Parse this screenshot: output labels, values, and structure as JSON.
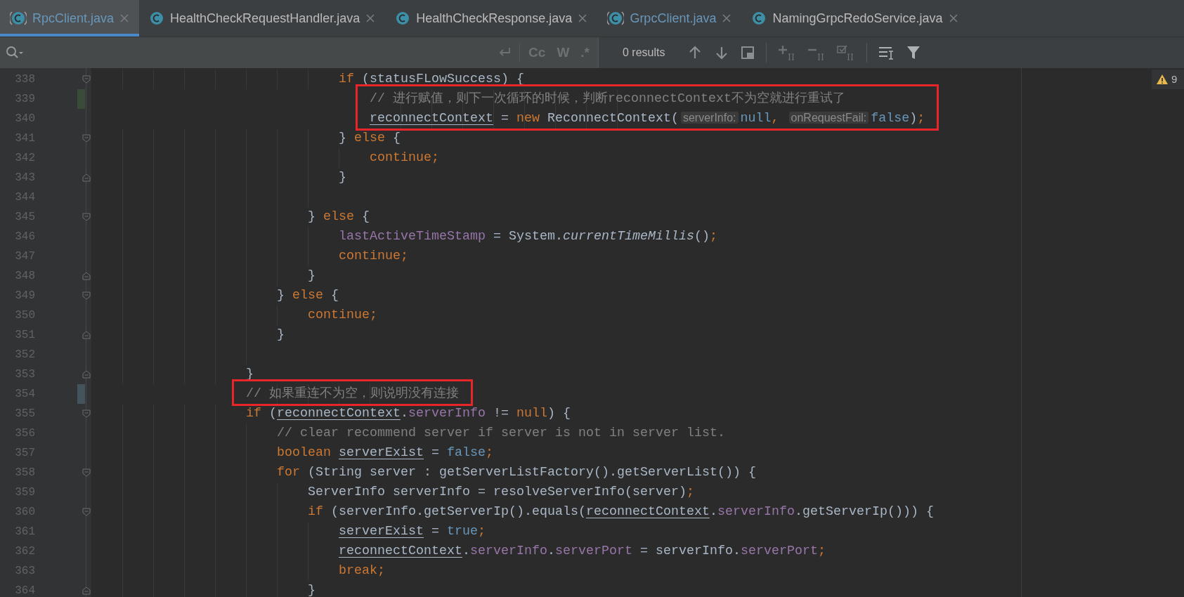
{
  "tabs": [
    {
      "label": "RpcClient.java",
      "selected": true,
      "modified": true,
      "kind": "abstract"
    },
    {
      "label": "HealthCheckRequestHandler.java",
      "selected": false,
      "modified": false,
      "kind": "plain"
    },
    {
      "label": "HealthCheckResponse.java",
      "selected": false,
      "modified": false,
      "kind": "plain"
    },
    {
      "label": "GrpcClient.java",
      "selected": false,
      "modified": true,
      "kind": "abstract"
    },
    {
      "label": "NamingGrpcRedoService.java",
      "selected": false,
      "modified": false,
      "kind": "plain"
    }
  ],
  "find_bar": {
    "options": [
      {
        "label": "Cc",
        "selected": false
      },
      {
        "label": "W",
        "selected": false
      },
      {
        "label": ".*",
        "selected": false
      }
    ],
    "results": "0 results"
  },
  "inspection": {
    "count": "9"
  },
  "lines": [
    {
      "children": [
        {
          "children": [
            {
              "children": [
                {
                  "number": "338",
                  "fold_start": true,
                  "fold_end": false,
                  "added": false,
                  "modified": false,
                  "boxed": false,
                  "tokens": [
                    {
                      "kind": "keyword",
                      "text": "if"
                    },
                    {
                      "kind": "plain",
                      "text": " (statusFLowSuccess) {"
                    }
                  ],
                  "children": [
                    {
                      "number": "339",
                      "fold_start": false,
                      "fold_end": false,
                      "added": true,
                      "modified": false,
                      "boxed": true,
                      "tokens": [
                        {
                          "kind": "comment",
                          "text": "// 进行赋值，则下一次循环的时候，判断reconnectContext不为空就进行重试了"
                        }
                      ]
                    },
                    {
                      "number": "340",
                      "fold_start": false,
                      "fold_end": false,
                      "added": false,
                      "modified": false,
                      "boxed": true,
                      "tokens": [
                        {
                          "kind": "variable",
                          "text": "reconnectContext"
                        },
                        {
                          "kind": "plain",
                          "text": " = "
                        },
                        {
                          "kind": "keyword",
                          "text": "new"
                        },
                        {
                          "kind": "plain",
                          "text": " ReconnectContext("
                        },
                        {
                          "kind": "hint",
                          "text": "serverInfo:"
                        },
                        {
                          "kind": "literal",
                          "text": "null"
                        },
                        {
                          "kind": "keyword",
                          "text": ", "
                        },
                        {
                          "kind": "hint",
                          "text": "onRequestFail:"
                        },
                        {
                          "kind": "literal",
                          "text": "false"
                        },
                        {
                          "kind": "plain",
                          "text": ")"
                        },
                        {
                          "kind": "keyword",
                          "text": ";"
                        }
                      ]
                    }
                  ]
                },
                {
                  "number": "341",
                  "fold_start": true,
                  "fold_end": false,
                  "added": false,
                  "modified": false,
                  "boxed": false,
                  "tokens": [
                    {
                      "kind": "plain",
                      "text": "} "
                    },
                    {
                      "kind": "keyword",
                      "text": "else"
                    },
                    {
                      "kind": "plain",
                      "text": " {"
                    }
                  ],
                  "children": [
                    {
                      "number": "342",
                      "fold_start": false,
                      "fold_end": false,
                      "added": false,
                      "modified": false,
                      "boxed": false,
                      "tokens": [
                        {
                          "kind": "keyword",
                          "text": "continue;"
                        }
                      ]
                    }
                  ]
                },
                {
                  "number": "343",
                  "fold_start": false,
                  "fold_end": true,
                  "added": false,
                  "modified": false,
                  "boxed": false,
                  "tokens": [
                    {
                      "kind": "plain",
                      "text": "}"
                    }
                  ]
                },
                {
                  "number": "344",
                  "fold_start": false,
                  "fold_end": false,
                  "added": false,
                  "modified": false,
                  "boxed": false
                }
              ]
            },
            {
              "number": "345",
              "fold_start": true,
              "fold_end": false,
              "added": false,
              "modified": false,
              "boxed": false,
              "tokens": [
                {
                  "kind": "plain",
                  "text": "} "
                },
                {
                  "kind": "keyword",
                  "text": "else"
                },
                {
                  "kind": "plain",
                  "text": " {"
                }
              ],
              "children": [
                {
                  "number": "346",
                  "fold_start": false,
                  "fold_end": false,
                  "added": false,
                  "modified": false,
                  "boxed": false,
                  "tokens": [
                    {
                      "kind": "field",
                      "text": "lastActiveTimeStamp"
                    },
                    {
                      "kind": "plain",
                      "text": " = System."
                    },
                    {
                      "kind": "static",
                      "text": "currentTimeMillis"
                    },
                    {
                      "kind": "plain",
                      "text": "()"
                    },
                    {
                      "kind": "keyword",
                      "text": ";"
                    }
                  ]
                },
                {
                  "number": "347",
                  "fold_start": false,
                  "fold_end": false,
                  "added": false,
                  "modified": false,
                  "boxed": false,
                  "tokens": [
                    {
                      "kind": "keyword",
                      "text": "continue;"
                    }
                  ]
                }
              ]
            },
            {
              "number": "348",
              "fold_start": false,
              "fold_end": true,
              "added": false,
              "modified": false,
              "boxed": false,
              "tokens": [
                {
                  "kind": "plain",
                  "text": "}"
                }
              ]
            }
          ]
        },
        {
          "number": "349",
          "fold_start": true,
          "fold_end": false,
          "added": false,
          "modified": false,
          "boxed": false,
          "tokens": [
            {
              "kind": "plain",
              "text": "} "
            },
            {
              "kind": "keyword",
              "text": "else"
            },
            {
              "kind": "plain",
              "text": " {"
            }
          ],
          "children": [
            {
              "number": "350",
              "fold_start": false,
              "fold_end": false,
              "added": false,
              "modified": false,
              "boxed": false,
              "tokens": [
                {
                  "kind": "keyword",
                  "text": "continue;"
                }
              ]
            }
          ]
        },
        {
          "number": "351",
          "fold_start": false,
          "fold_end": true,
          "added": false,
          "modified": false,
          "boxed": false,
          "tokens": [
            {
              "kind": "plain",
              "text": "}"
            }
          ]
        },
        {
          "number": "352",
          "fold_start": false,
          "fold_end": false,
          "added": false,
          "modified": false,
          "boxed": false
        }
      ]
    },
    {
      "number": "353",
      "fold_start": false,
      "fold_end": true,
      "added": false,
      "modified": false,
      "boxed": false,
      "tokens": [
        {
          "kind": "plain",
          "text": "}"
        }
      ]
    },
    {
      "number": "354",
      "fold_start": false,
      "fold_end": false,
      "added": false,
      "modified": true,
      "boxed": true,
      "tokens": [
        {
          "kind": "comment",
          "text": "// 如果重连不为空，则说明没有连接"
        }
      ]
    },
    {
      "number": "355",
      "fold_start": true,
      "fold_end": false,
      "added": false,
      "modified": false,
      "boxed": false,
      "tokens": [
        {
          "kind": "keyword",
          "text": "if"
        },
        {
          "kind": "plain",
          "text": " ("
        },
        {
          "kind": "variable",
          "text": "reconnectContext"
        },
        {
          "kind": "plain",
          "text": "."
        },
        {
          "kind": "field",
          "text": "serverInfo"
        },
        {
          "kind": "plain",
          "text": " != "
        },
        {
          "kind": "keyword",
          "text": "null"
        },
        {
          "kind": "plain",
          "text": ") {"
        }
      ],
      "children": [
        {
          "number": "356",
          "fold_start": false,
          "fold_end": false,
          "added": false,
          "modified": false,
          "boxed": false,
          "tokens": [
            {
              "kind": "comment",
              "text": "// clear recommend server if server is not in server list."
            }
          ]
        },
        {
          "number": "357",
          "fold_start": false,
          "fold_end": false,
          "added": false,
          "modified": false,
          "boxed": false,
          "tokens": [
            {
              "kind": "keyword",
              "text": "boolean "
            },
            {
              "kind": "variable",
              "text": "serverExist"
            },
            {
              "kind": "plain",
              "text": " = "
            },
            {
              "kind": "literal",
              "text": "false"
            },
            {
              "kind": "keyword",
              "text": ";"
            }
          ]
        },
        {
          "number": "358",
          "fold_start": true,
          "fold_end": false,
          "added": false,
          "modified": false,
          "boxed": false,
          "tokens": [
            {
              "kind": "keyword",
              "text": "for"
            },
            {
              "kind": "plain",
              "text": " (String server : getServerListFactory().getServerList()) {"
            }
          ],
          "children": [
            {
              "number": "359",
              "fold_start": false,
              "fold_end": false,
              "added": false,
              "modified": false,
              "boxed": false,
              "tokens": [
                {
                  "kind": "plain",
                  "text": "ServerInfo serverInfo = resolveServerInfo(server)"
                },
                {
                  "kind": "keyword",
                  "text": ";"
                }
              ]
            },
            {
              "number": "360",
              "fold_start": true,
              "fold_end": false,
              "added": false,
              "modified": false,
              "boxed": false,
              "tokens": [
                {
                  "kind": "keyword",
                  "text": "if"
                },
                {
                  "kind": "plain",
                  "text": " (serverInfo.getServerIp().equals("
                },
                {
                  "kind": "variable",
                  "text": "reconnectContext"
                },
                {
                  "kind": "plain",
                  "text": "."
                },
                {
                  "kind": "field",
                  "text": "serverInfo"
                },
                {
                  "kind": "plain",
                  "text": ".getServerIp())) {"
                }
              ],
              "children": [
                {
                  "number": "361",
                  "fold_start": false,
                  "fold_end": false,
                  "added": false,
                  "modified": false,
                  "boxed": false,
                  "tokens": [
                    {
                      "kind": "variable",
                      "text": "serverExist"
                    },
                    {
                      "kind": "plain",
                      "text": " = "
                    },
                    {
                      "kind": "literal",
                      "text": "true"
                    },
                    {
                      "kind": "keyword",
                      "text": ";"
                    }
                  ]
                },
                {
                  "number": "362",
                  "fold_start": false,
                  "fold_end": false,
                  "added": false,
                  "modified": false,
                  "boxed": false,
                  "tokens": [
                    {
                      "kind": "variable",
                      "text": "reconnectContext"
                    },
                    {
                      "kind": "plain",
                      "text": "."
                    },
                    {
                      "kind": "field",
                      "text": "serverInfo"
                    },
                    {
                      "kind": "plain",
                      "text": "."
                    },
                    {
                      "kind": "field",
                      "text": "serverPort"
                    },
                    {
                      "kind": "plain",
                      "text": " = serverInfo."
                    },
                    {
                      "kind": "field",
                      "text": "serverPort"
                    },
                    {
                      "kind": "keyword",
                      "text": ";"
                    }
                  ]
                },
                {
                  "number": "363",
                  "fold_start": false,
                  "fold_end": false,
                  "added": false,
                  "modified": false,
                  "boxed": false,
                  "tokens": [
                    {
                      "kind": "keyword",
                      "text": "break;"
                    }
                  ]
                }
              ]
            },
            {
              "number": "364",
              "fold_start": false,
              "fold_end": true,
              "added": false,
              "modified": false,
              "boxed": false,
              "tokens": [
                {
                  "kind": "plain",
                  "text": "}"
                }
              ]
            }
          ]
        }
      ]
    }
  ]
}
